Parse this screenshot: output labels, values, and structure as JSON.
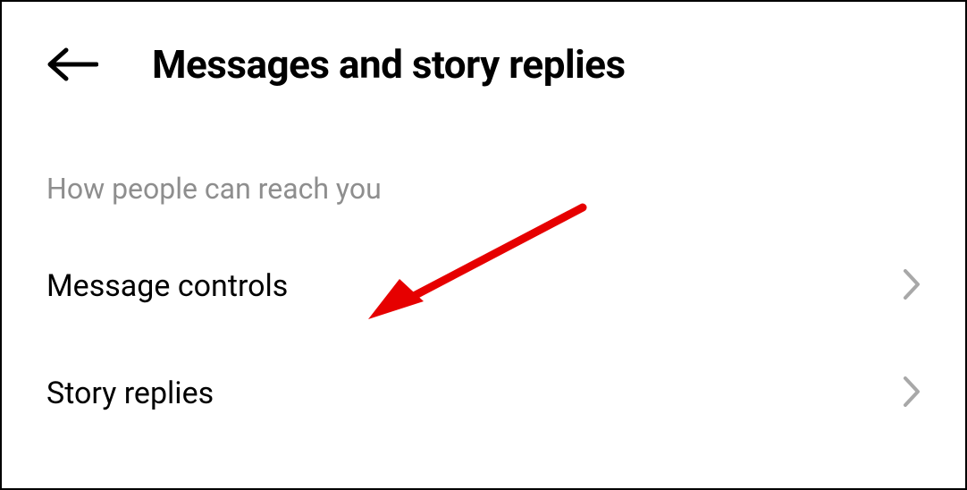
{
  "header": {
    "title": "Messages and story replies"
  },
  "section": {
    "label": "How people can reach you"
  },
  "items": [
    {
      "label": "Message controls"
    },
    {
      "label": "Story replies"
    }
  ]
}
